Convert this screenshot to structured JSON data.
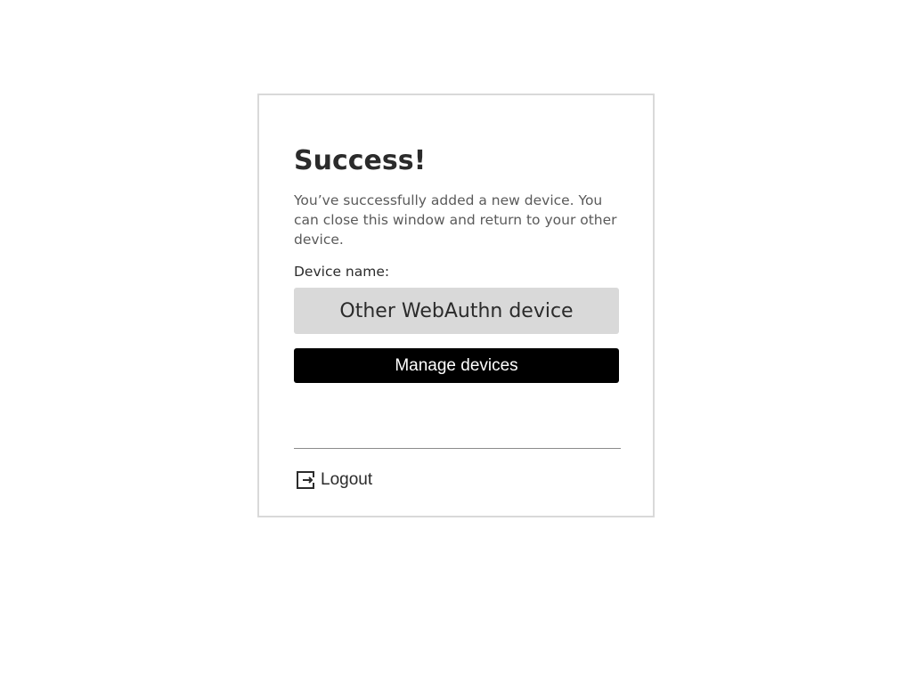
{
  "card": {
    "title": "Success!",
    "message": "You’ve successfully added a new device. You can close this window and return to your other device.",
    "device_label": "Device name:",
    "device_name": "Other WebAuthn device",
    "manage_button_label": "Manage devices",
    "logout_label": "Logout",
    "logout_icon": "logout-icon"
  },
  "colors": {
    "button_bg": "#000000",
    "device_box_bg": "#d9d9d9",
    "card_border": "#d9d9d9"
  }
}
